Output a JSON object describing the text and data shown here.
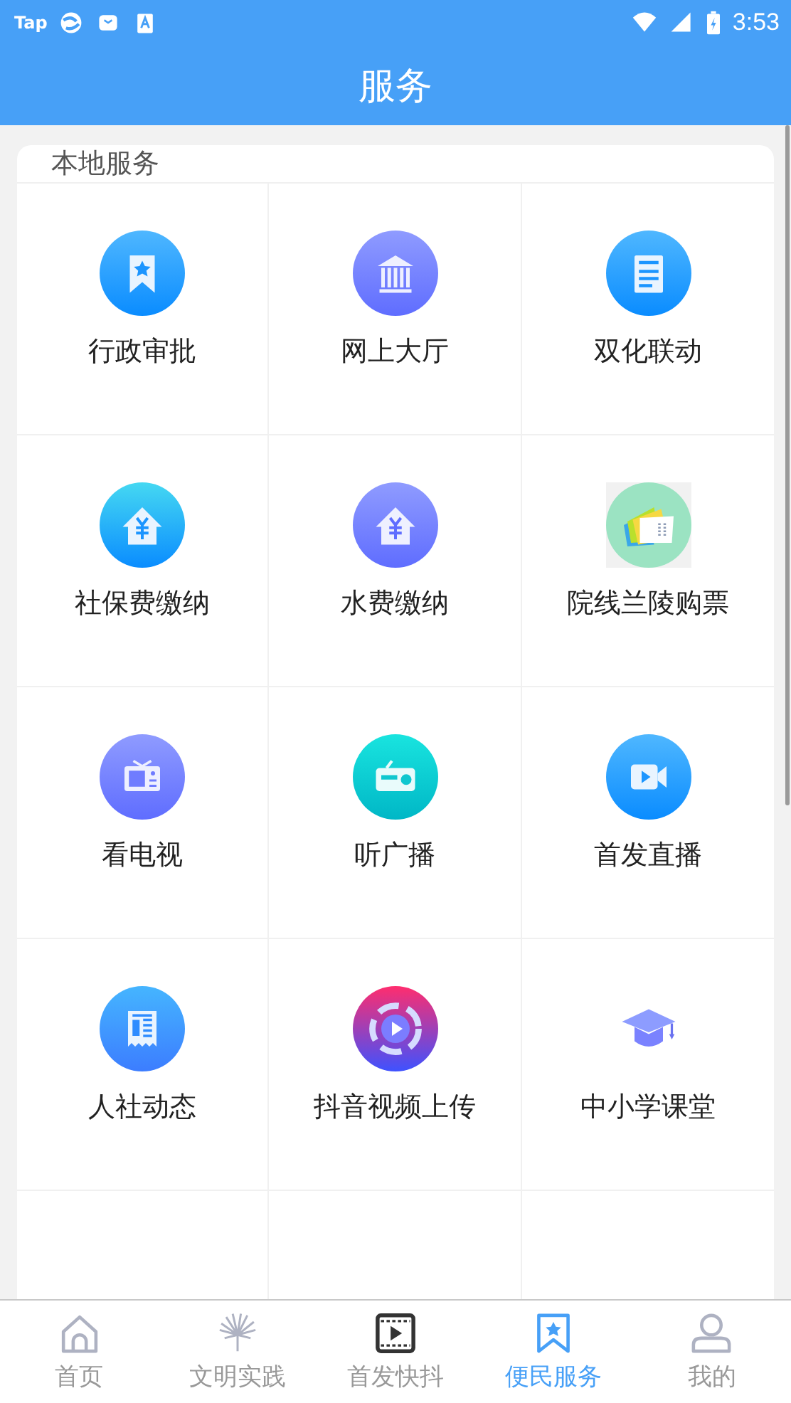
{
  "status_bar": {
    "time": "3:53",
    "app_label": "Tap"
  },
  "header": {
    "title": "服务"
  },
  "section": {
    "title": "本地服务",
    "items": [
      {
        "label": "行政审批",
        "kind": "bookmark"
      },
      {
        "label": "网上大厅",
        "kind": "bank"
      },
      {
        "label": "双化联动",
        "kind": "document"
      },
      {
        "label": "社保费缴纳",
        "kind": "house-cyan"
      },
      {
        "label": "水费缴纳",
        "kind": "house-violet"
      },
      {
        "label": "院线兰陵购票",
        "kind": "tickets"
      },
      {
        "label": "看电视",
        "kind": "tv"
      },
      {
        "label": "听广播",
        "kind": "radio"
      },
      {
        "label": "首发直播",
        "kind": "camera"
      },
      {
        "label": "人社动态",
        "kind": "newspaper"
      },
      {
        "label": "抖音视频上传",
        "kind": "play"
      },
      {
        "label": "中小学课堂",
        "kind": "cap"
      }
    ]
  },
  "tabs": [
    {
      "label": "首页",
      "kind": "home",
      "selected": false
    },
    {
      "label": "文明实践",
      "kind": "peacock",
      "selected": false
    },
    {
      "label": "首发快抖",
      "kind": "film",
      "selected": false
    },
    {
      "label": "便民服务",
      "kind": "bookmark",
      "selected": true
    },
    {
      "label": "我的",
      "kind": "person",
      "selected": false
    }
  ]
}
